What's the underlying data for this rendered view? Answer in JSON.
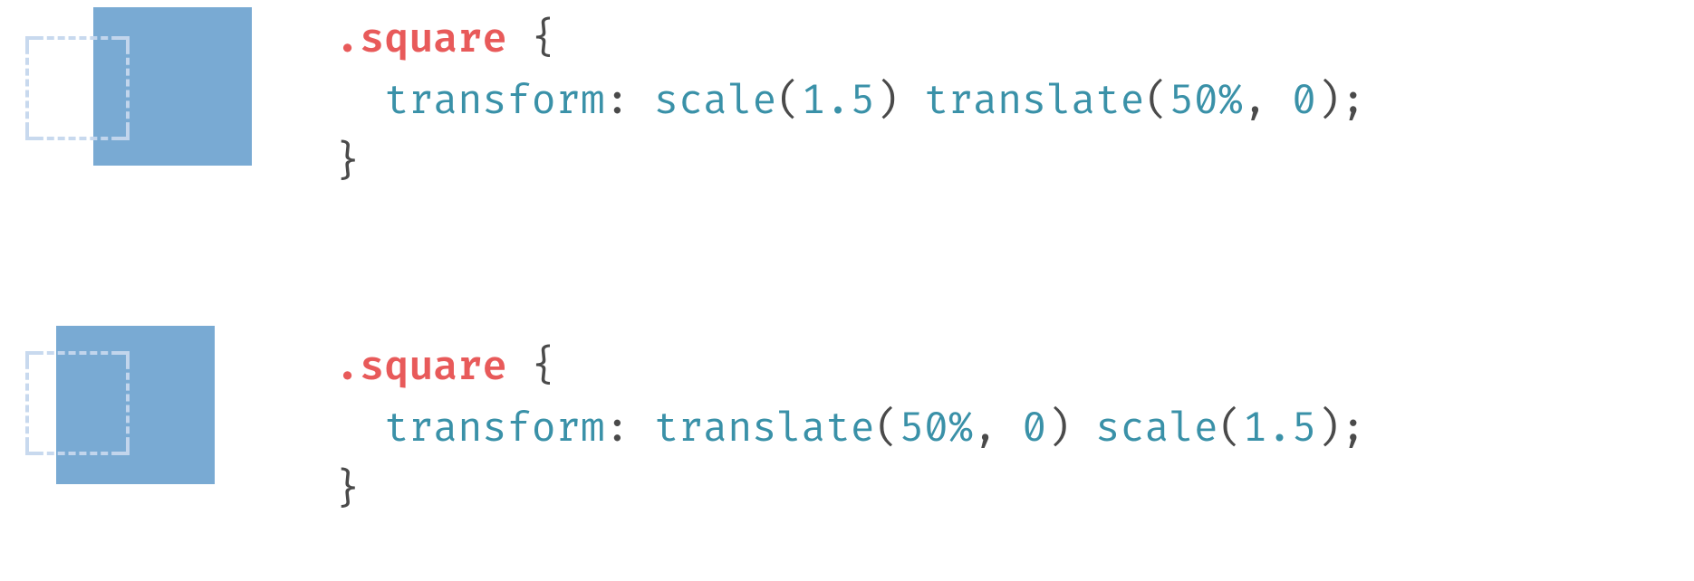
{
  "example1": {
    "selector": ".square",
    "open": " {",
    "indent": "  ",
    "prop": "transform",
    "colon": ": ",
    "fn1": "scale",
    "lp1": "(",
    "arg1": "1.5",
    "rp1": ")",
    "space": " ",
    "fn2": "translate",
    "lp2": "(",
    "arg2a": "50%",
    "comma": ", ",
    "arg2b": "0",
    "rp2": ")",
    "semi": ";",
    "close": "}"
  },
  "example2": {
    "selector": ".square",
    "open": " {",
    "indent": "  ",
    "prop": "transform",
    "colon": ": ",
    "fn1": "translate",
    "lp1": "(",
    "arg1a": "50%",
    "comma": ", ",
    "arg1b": "0",
    "rp1": ")",
    "space": " ",
    "fn2": "scale",
    "lp2": "(",
    "arg2": "1.5",
    "rp2": ")",
    "semi": ";",
    "close": "}"
  }
}
